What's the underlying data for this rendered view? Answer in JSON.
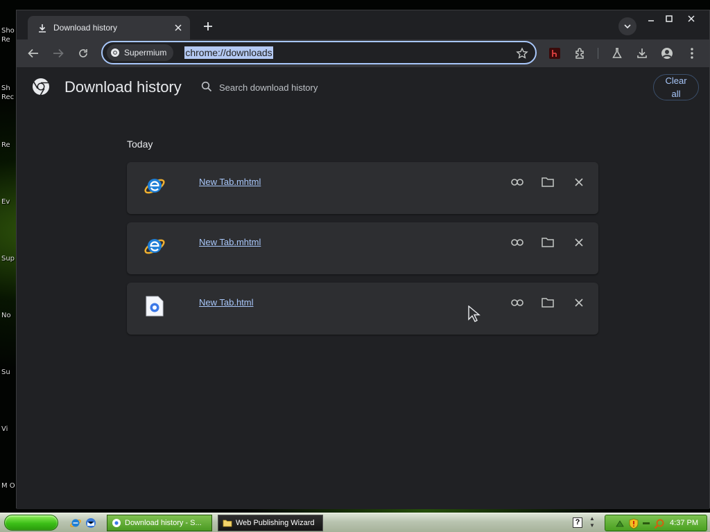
{
  "desktop": {
    "labels": [
      "Sho Re",
      "Sh Rec",
      "Re",
      "Ev",
      "Sup",
      "No",
      "Su",
      "Vi",
      "M O"
    ]
  },
  "window": {
    "tab_title": "Download history",
    "site_chip": "Supermium",
    "url": "chrome://downloads"
  },
  "page": {
    "title": "Download history",
    "search_placeholder": "Search download history",
    "clear_all": "Clear all",
    "section_label": "Today",
    "downloads": [
      {
        "name": "New Tab.mhtml",
        "icon": "internet-explorer-icon"
      },
      {
        "name": "New Tab.mhtml",
        "icon": "internet-explorer-icon"
      },
      {
        "name": "New Tab.html",
        "icon": "html-file-icon"
      }
    ]
  },
  "taskbar": {
    "tasks": [
      {
        "label": "Download history - S..."
      },
      {
        "label": "Web Publishing Wizard"
      }
    ],
    "help": "?",
    "clock": "4:37 PM"
  },
  "colors": {
    "accent": "#a8c7fa",
    "page_bg": "#202124",
    "card_bg": "#2d2e31",
    "toolbar_bg": "#35363a"
  }
}
